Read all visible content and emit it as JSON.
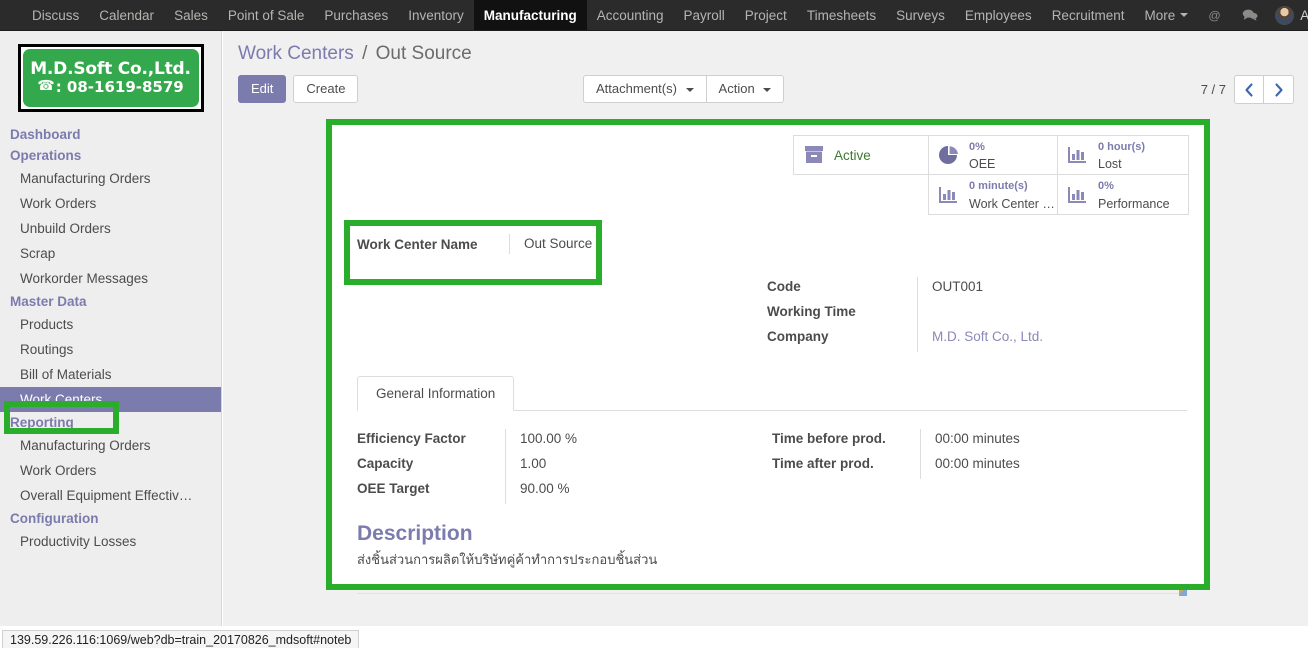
{
  "navbar": {
    "items": [
      {
        "label": "Discuss",
        "active": false
      },
      {
        "label": "Calendar",
        "active": false
      },
      {
        "label": "Sales",
        "active": false
      },
      {
        "label": "Point of Sale",
        "active": false
      },
      {
        "label": "Purchases",
        "active": false
      },
      {
        "label": "Inventory",
        "active": false
      },
      {
        "label": "Manufacturing",
        "active": true
      },
      {
        "label": "Accounting",
        "active": false
      },
      {
        "label": "Payroll",
        "active": false
      },
      {
        "label": "Project",
        "active": false
      },
      {
        "label": "Timesheets",
        "active": false
      },
      {
        "label": "Surveys",
        "active": false
      },
      {
        "label": "Employees",
        "active": false
      },
      {
        "label": "Recruitment",
        "active": false
      },
      {
        "label": "More",
        "active": false
      }
    ],
    "mention_icon": "@",
    "chat_icon": "●",
    "user_name": "Administrator"
  },
  "sidebar": {
    "logo": {
      "company": "M.D.Soft Co.,Ltd.",
      "phone": ": 08-1619-8579",
      "bg_color": "#34a84c"
    },
    "entries": [
      {
        "label": "Dashboard",
        "type": "section"
      },
      {
        "label": "Operations",
        "type": "section"
      },
      {
        "label": "Manufacturing Orders",
        "type": "item"
      },
      {
        "label": "Work Orders",
        "type": "item"
      },
      {
        "label": "Unbuild Orders",
        "type": "item"
      },
      {
        "label": "Scrap",
        "type": "item"
      },
      {
        "label": "Workorder Messages",
        "type": "item"
      },
      {
        "label": "Master Data",
        "type": "section"
      },
      {
        "label": "Products",
        "type": "item"
      },
      {
        "label": "Routings",
        "type": "item"
      },
      {
        "label": "Bill of Materials",
        "type": "item"
      },
      {
        "label": "Work Centers",
        "type": "item",
        "active": true
      },
      {
        "label": "Reporting",
        "type": "section"
      },
      {
        "label": "Manufacturing Orders",
        "type": "item"
      },
      {
        "label": "Work Orders",
        "type": "item"
      },
      {
        "label": "Overall Equipment Effectiv…",
        "type": "item"
      },
      {
        "label": "Configuration",
        "type": "section"
      },
      {
        "label": "Productivity Losses",
        "type": "item"
      }
    ]
  },
  "breadcrumb": {
    "parent": "Work Centers",
    "separator": "/",
    "current": "Out Source"
  },
  "toolbar": {
    "edit_label": "Edit",
    "create_label": "Create",
    "attachments_label": "Attachment(s)",
    "action_label": "Action",
    "pager_text": "7 / 7",
    "prev_icon": "‹",
    "next_icon": "›"
  },
  "stat_buttons": [
    {
      "value": "",
      "label": "Active",
      "icon": "archive-icon",
      "kind": "active"
    },
    {
      "value": "0%",
      "label": "OEE",
      "icon": "pie-chart-icon",
      "kind": "stat"
    },
    {
      "value": "0 hour(s)",
      "label": "Lost",
      "icon": "bar-chart-icon",
      "kind": "stat"
    },
    {
      "value": "0 minute(s)",
      "label": "Work Center …",
      "icon": "bar-chart-icon",
      "kind": "stat"
    },
    {
      "value": "0%",
      "label": "Performance",
      "icon": "bar-chart-icon",
      "kind": "stat"
    }
  ],
  "form": {
    "name_field": {
      "label": "Work Center Name",
      "value": "Out Source"
    },
    "right_fields": [
      {
        "label": "Code",
        "value": "OUT001",
        "link": false
      },
      {
        "label": "Working Time",
        "value": "",
        "link": false
      },
      {
        "label": "Company",
        "value": "M.D. Soft Co., Ltd.",
        "link": true
      }
    ],
    "tab_label": "General Information",
    "left_fields": [
      {
        "label": "Efficiency Factor",
        "value": "100.00  %"
      },
      {
        "label": "Capacity",
        "value": "1.00"
      },
      {
        "label": "OEE Target",
        "value": "90.00  %"
      }
    ],
    "right_tab_fields": [
      {
        "label": "Time before prod.",
        "value": "00:00 minutes"
      },
      {
        "label": "Time after prod.",
        "value": "00:00 minutes"
      }
    ],
    "description_title": "Description",
    "description_text": "ส่งชิ้นส่วนการผลิตให้บริษัทคู่ค้าทำการประกอบชิ้นส่วน"
  },
  "statusbar": {
    "url": "139.59.226.116:1069/web?db=train_20170826_mdsoft#noteb"
  },
  "annotations": {
    "highlight_color": "#2aad2a"
  }
}
